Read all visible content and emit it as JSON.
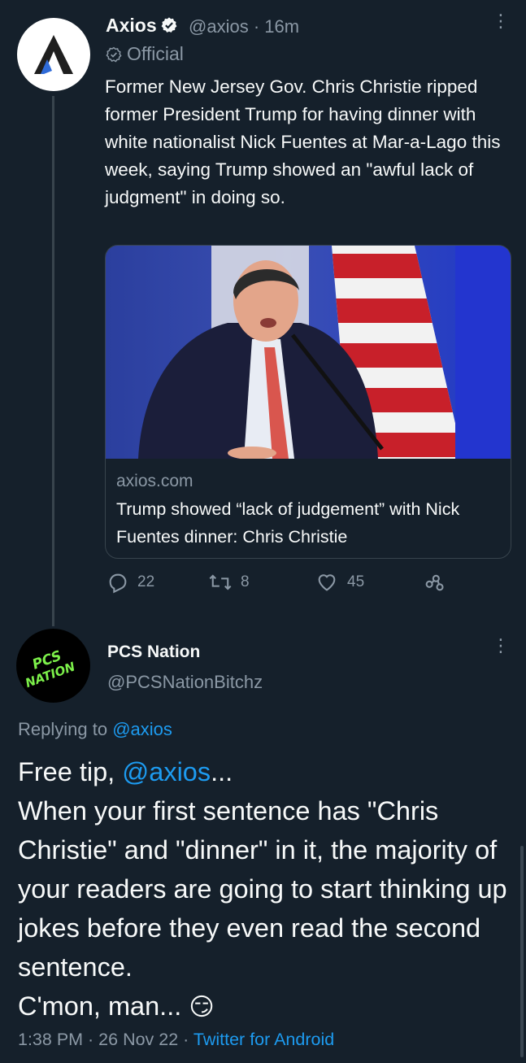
{
  "tweet": {
    "author_name": "Axios",
    "handle": "@axios",
    "time": "· 16m",
    "official_label": "Official",
    "text": "Former New Jersey Gov. Chris Christie ripped former President Trump for having dinner with white nationalist Nick Fuentes at Mar-a-Lago this week, saying Trump showed an \"awful lack of judgment\" in doing so.",
    "card": {
      "domain": "axios.com",
      "title": "Trump showed “lack of judgement” with Nick Fuentes dinner: Chris Christie"
    },
    "actions": {
      "replies": "22",
      "retweets": "8",
      "likes": "45"
    },
    "more_glyph": "⋮"
  },
  "reply": {
    "author_name": "PCS Nation",
    "handle": "@PCSNationBitchz",
    "avatar_text": [
      "PCS",
      "NATION"
    ],
    "replying_prefix": "Replying to",
    "replying_handle": "@axios",
    "text_pre": "Free tip, ",
    "mention": "@axios",
    "text_post": "...\nWhen your first sentence has \"Chris Christie\" and \"dinner\" in it, the majority of your readers are going to start thinking up jokes before they even read the second sentence.\nC'mon, man... ",
    "emoji": "😏",
    "footer_time": "1:38 PM · 26 Nov 22 · ",
    "footer_source": "Twitter for Android",
    "more_glyph": "⋮"
  },
  "colors": {
    "background": "#15202b",
    "text": "#f7f9f9",
    "muted": "#8b98a5",
    "link": "#1d9bf0",
    "border": "#38444d",
    "avatar_green": "#7cf04a"
  },
  "icons": [
    "axios-logo-icon",
    "verified-badge-icon",
    "official-check-icon",
    "more-icon",
    "reply-icon",
    "retweet-icon",
    "like-icon",
    "share-icon"
  ]
}
